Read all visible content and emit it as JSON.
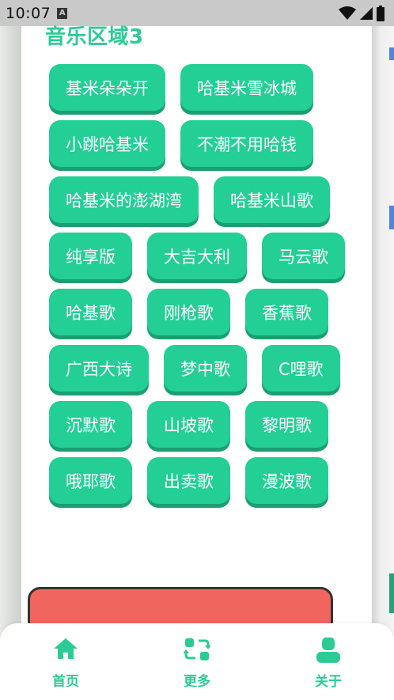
{
  "status_bar": {
    "time": "10:07",
    "notification": "A"
  },
  "section": {
    "title": "音乐区域3"
  },
  "chips": [
    "基米朵朵开",
    "哈基米雪冰城",
    "小跳哈基米",
    "不潮不用哈钱",
    "哈基米的澎湖湾",
    "哈基米山歌",
    "纯享版",
    "大吉大利",
    "马云歌",
    "哈基歌",
    "刚枪歌",
    "香蕉歌",
    "广西大诗",
    "梦中歌",
    "C哩歌",
    "沉默歌",
    "山坡歌",
    "黎明歌",
    "哦耶歌",
    "出卖歌",
    "漫波歌"
  ],
  "nav": {
    "home": {
      "label": "首页",
      "icon": "home-icon"
    },
    "more": {
      "label": "更多",
      "icon": "swap-icon"
    },
    "about": {
      "label": "关于",
      "icon": "user-icon"
    }
  },
  "colors": {
    "accent": "#23cf95",
    "accent_shadow": "#1a9f71",
    "title": "#2ccb95",
    "danger": "#f0665f"
  }
}
